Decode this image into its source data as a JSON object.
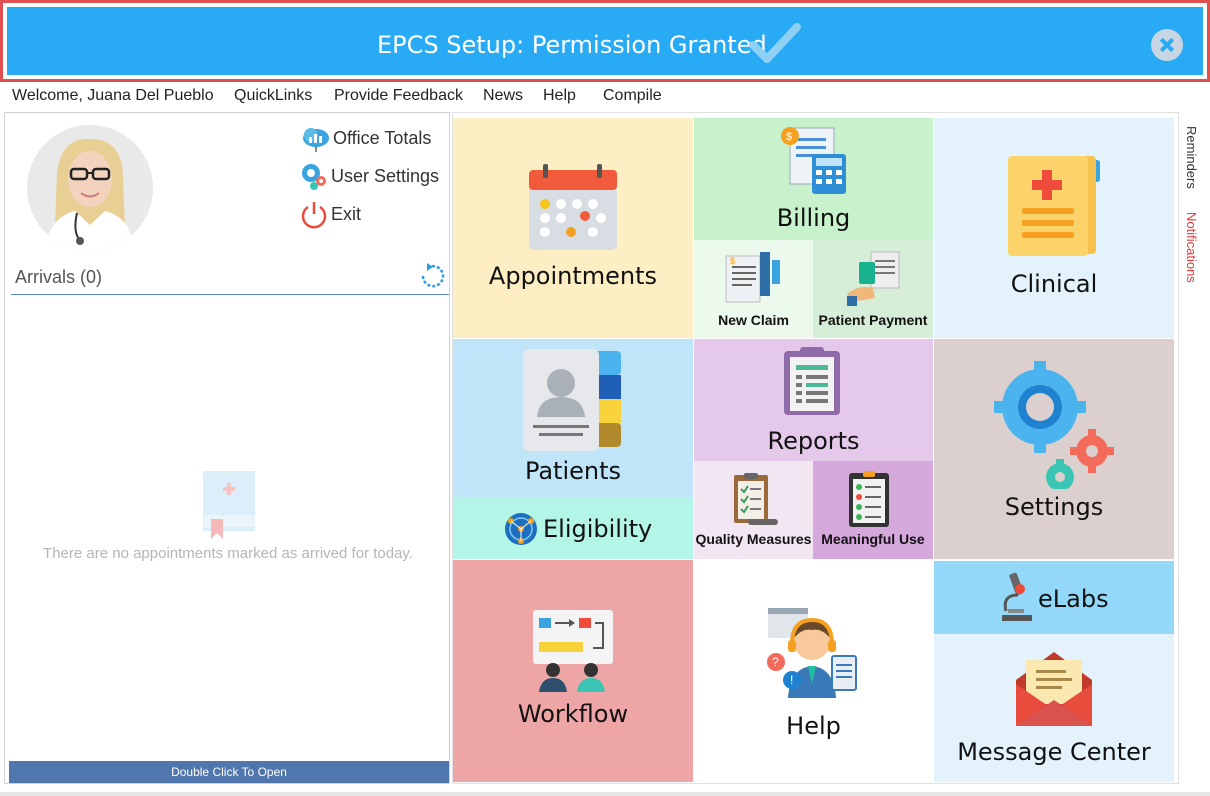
{
  "banner": {
    "message": "EPCS Setup: Permission Granted",
    "icon": "check-icon",
    "close_icon": "close-icon",
    "color": "#29aaf5"
  },
  "menu": {
    "welcome": "Welcome, Juana Del Pueblo",
    "quicklinks": "QuickLinks",
    "feedback": "Provide Feedback",
    "news": "News",
    "help": "Help",
    "compile": "Compile"
  },
  "profile": {
    "office_totals": "Office Totals",
    "user_settings": "User Settings",
    "exit": "Exit"
  },
  "arrivals": {
    "title": "Arrivals (0)",
    "empty_message": "There are no appointments marked as arrived for today.",
    "open_button": "Double Click To Open"
  },
  "tiles": {
    "appointments": "Appointments",
    "billing": "Billing",
    "new_claim": "New Claim",
    "patient_payment": "Patient Payment",
    "clinical": "Clinical",
    "patients": "Patients",
    "eligibility": "Eligibility",
    "reports": "Reports",
    "quality_measures": "Quality Measures",
    "meaningful_use": "Meaningful Use",
    "settings": "Settings",
    "workflow": "Workflow",
    "help": "Help",
    "elabs": "eLabs",
    "message_center": "Message Center"
  },
  "side_tabs": {
    "reminders": "Reminders",
    "notifications": "Notifications"
  },
  "colors": {
    "appointments": "#fdefc3",
    "billing": "#c7f2cc",
    "clinical": "#e4f2fb",
    "patients": "#c0e5f8",
    "eligibility": "#b3f5e6",
    "reports": "#e4c9ea",
    "settings": "#dbd0cd",
    "workflow": "#eea5a5",
    "elabs": "#93d8f8",
    "message_center": "#e4f2fb"
  }
}
